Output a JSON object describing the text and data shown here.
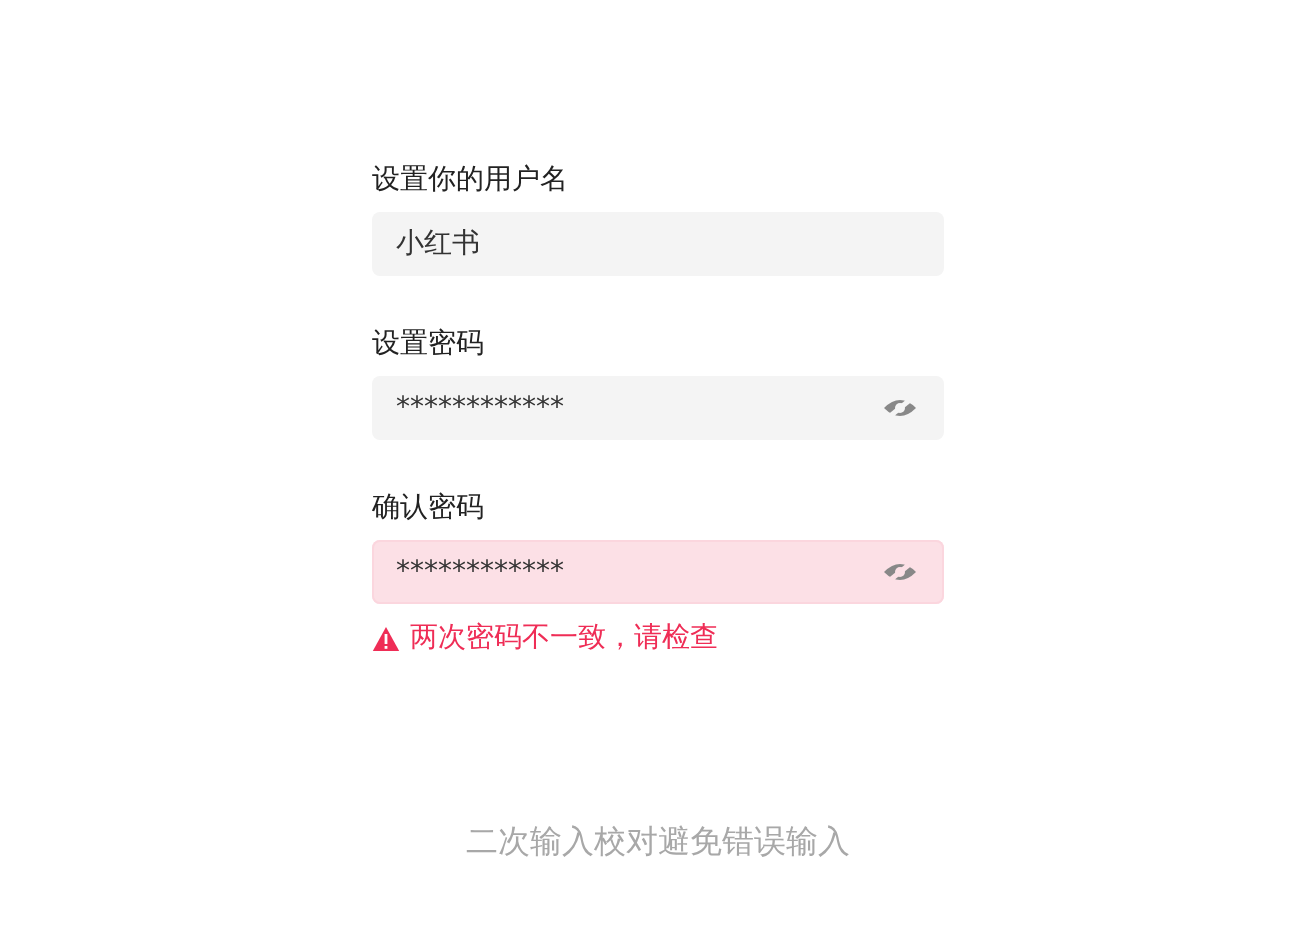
{
  "fields": [
    {
      "label": "设置你的用户名",
      "kind": "text",
      "value": "小红书",
      "error": false
    },
    {
      "label": "设置密码",
      "kind": "password",
      "value": "************",
      "error": false
    },
    {
      "label": "确认密码",
      "kind": "password",
      "value": "************",
      "error": true,
      "error_message": "两次密码不一致，请检查"
    }
  ],
  "caption": "二次输入校对避免错误输入"
}
